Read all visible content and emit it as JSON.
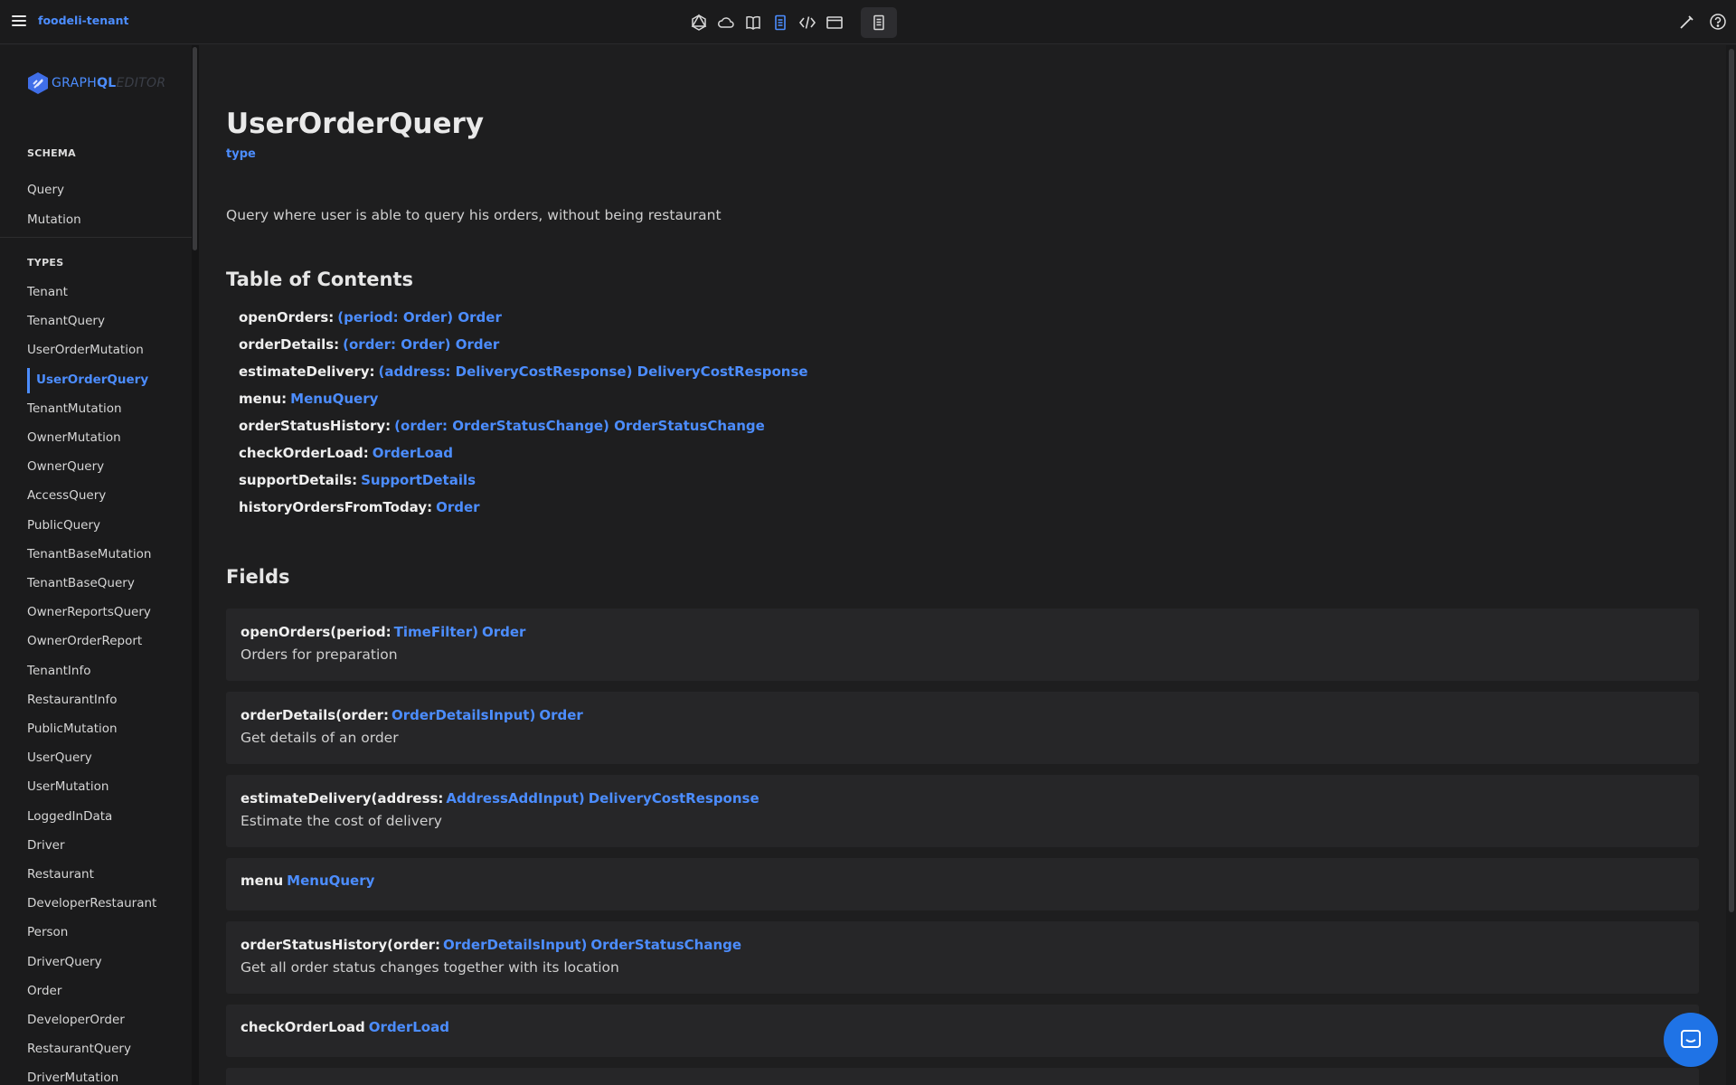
{
  "header": {
    "project_name": "foodeli-tenant",
    "icons": [
      "graphql-icon",
      "cloud-icon",
      "book-icon",
      "document-icon",
      "code-icon",
      "window-icon",
      "docs-icon"
    ],
    "right_icons": [
      "pen-icon",
      "help-icon"
    ],
    "accent": "#4c8dff"
  },
  "sidebar": {
    "logo": {
      "part1": "GRAPH",
      "part2": "QL",
      "part3": "EDITOR"
    },
    "schema_heading": "SCHEMA",
    "schema_items": [
      "Query",
      "Mutation"
    ],
    "types_heading": "TYPES",
    "type_items": [
      "Tenant",
      "TenantQuery",
      "UserOrderMutation",
      "UserOrderQuery",
      "TenantMutation",
      "OwnerMutation",
      "OwnerQuery",
      "AccessQuery",
      "PublicQuery",
      "TenantBaseMutation",
      "TenantBaseQuery",
      "OwnerReportsQuery",
      "OwnerOrderReport",
      "TenantInfo",
      "RestaurantInfo",
      "PublicMutation",
      "UserQuery",
      "UserMutation",
      "LoggedInData",
      "Driver",
      "Restaurant",
      "DeveloperRestaurant",
      "Person",
      "DriverQuery",
      "Order",
      "DeveloperOrder",
      "RestaurantQuery",
      "DriverMutation"
    ],
    "active_item": "UserOrderQuery"
  },
  "main": {
    "title": "UserOrderQuery",
    "kind": "type",
    "description": "Query where user is able to query his orders, without being restaurant",
    "toc_heading": "Table of Contents",
    "toc": [
      {
        "name": "openOrders:",
        "link": "(period: Order) Order"
      },
      {
        "name": "orderDetails:",
        "link": "(order: Order) Order"
      },
      {
        "name": "estimateDelivery:",
        "link": "(address: DeliveryCostResponse) DeliveryCostResponse"
      },
      {
        "name": "menu:",
        "link": "MenuQuery"
      },
      {
        "name": "orderStatusHistory:",
        "link": "(order: OrderStatusChange) OrderStatusChange"
      },
      {
        "name": "checkOrderLoad:",
        "link": "OrderLoad"
      },
      {
        "name": "supportDetails:",
        "link": "SupportDetails"
      },
      {
        "name": "historyOrdersFromToday:",
        "link": "Order"
      }
    ],
    "fields_heading": "Fields",
    "fields": [
      {
        "prefix": "openOrders(period:",
        "arg_type": "TimeFilter)",
        "return_type": "Order",
        "description": "Orders for preparation"
      },
      {
        "prefix": "orderDetails(order:",
        "arg_type": "OrderDetailsInput)",
        "return_type": "Order",
        "description": "Get details of an order"
      },
      {
        "prefix": "estimateDelivery(address:",
        "arg_type": "AddressAddInput)",
        "return_type": "DeliveryCostResponse",
        "description": "Estimate the cost of delivery"
      },
      {
        "prefix": "menu",
        "arg_type": "",
        "return_type": "MenuQuery",
        "description": ""
      },
      {
        "prefix": "orderStatusHistory(order:",
        "arg_type": "OrderDetailsInput)",
        "return_type": "OrderStatusChange",
        "description": "Get all order status changes together with its location"
      },
      {
        "prefix": "checkOrderLoad",
        "arg_type": "",
        "return_type": "OrderLoad",
        "description": ""
      }
    ]
  }
}
